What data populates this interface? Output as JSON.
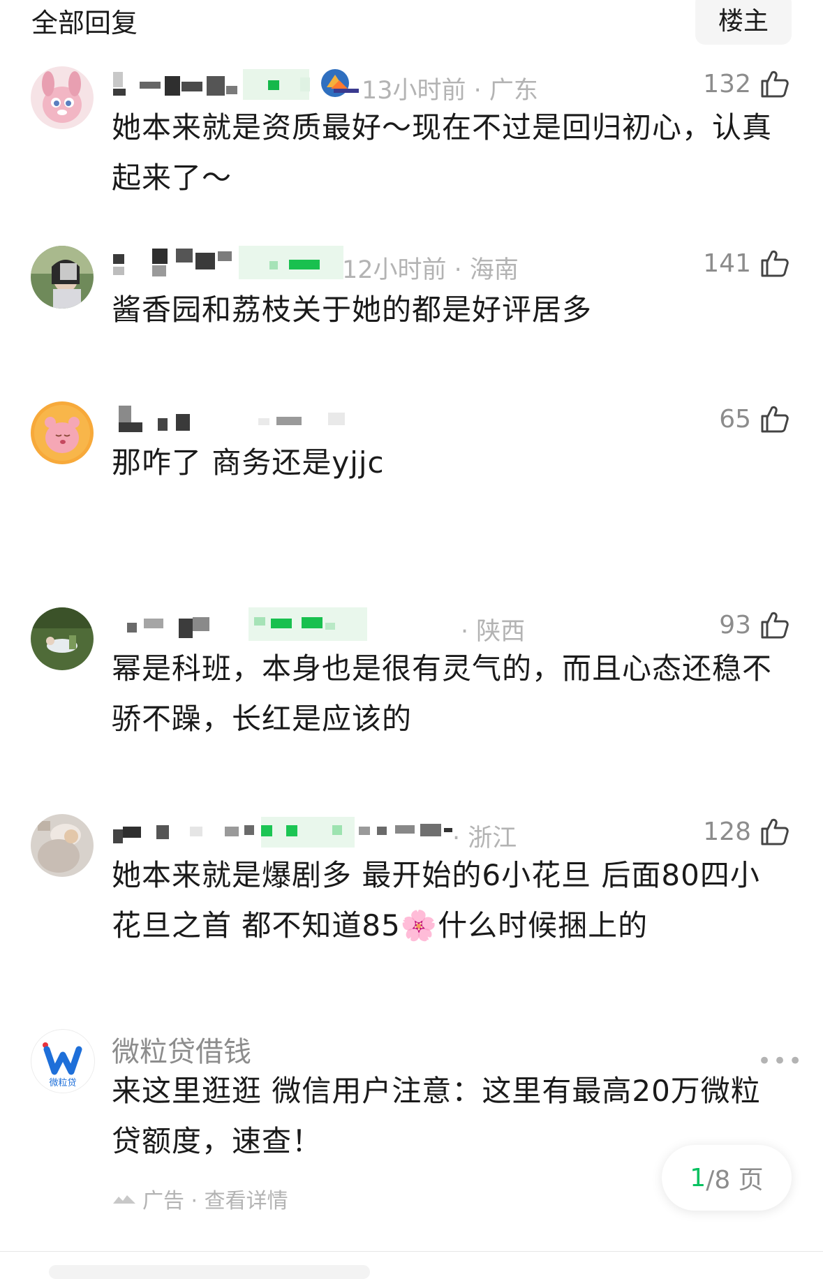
{
  "header": {
    "title": "全部回复",
    "op_filter_label": "楼主"
  },
  "comments": [
    {
      "meta": "13小时前 · 广东",
      "likes": "132",
      "text": "她本来就是资质最好～现在不过是回归初心，认真起来了～"
    },
    {
      "meta": "12小时前 · 海南",
      "likes": "141",
      "text": "酱香园和荔枝关于她的都是好评居多"
    },
    {
      "meta": "",
      "likes": "65",
      "text": "那咋了 商务还是yjjc"
    },
    {
      "meta": "· 陕西",
      "likes": "93",
      "text": "幂是科班，本身也是很有灵气的，而且心态还稳不骄不躁，长红是应该的"
    },
    {
      "meta": "· 浙江",
      "likes": "128",
      "text": "她本来就是爆剧多 最开始的6小花旦 后面80四小花旦之首 都不知道85🌸什么时候捆上的"
    }
  ],
  "ad": {
    "logo_text": "微粒贷",
    "name": "微粒贷借钱",
    "more": "•••",
    "text": "来这里逛逛 微信用户注意：这里有最高20万微粒贷额度，速查！",
    "footer": "广告 · 查看详情"
  },
  "pager": {
    "current": "1",
    "total": "/8 页"
  },
  "colors": {
    "accent_green": "#07c160",
    "meta_gray": "#b3b3b3",
    "like_gray": "#8c8c8c"
  },
  "icons": {
    "like": "thumbs-up-icon",
    "ad_mark": "ad-mark-icon"
  }
}
